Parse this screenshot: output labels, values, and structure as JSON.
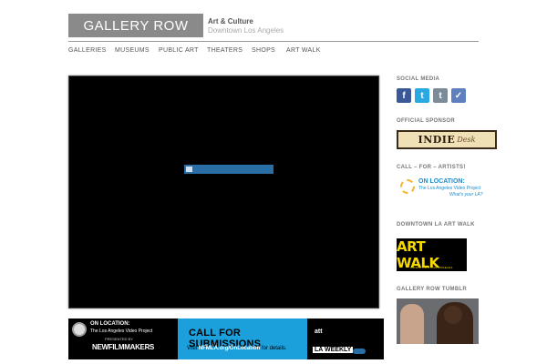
{
  "header": {
    "logo_text": "GALLERY ROW",
    "tagline_line1": "Art & Culture",
    "tagline_line2": "Downtown Los Angeles"
  },
  "nav": {
    "items": [
      {
        "label": "GALLERIES"
      },
      {
        "label": "MUSEUMS"
      },
      {
        "label": "PUBLIC ART"
      },
      {
        "label": "THEATERS"
      },
      {
        "label": "SHOPS"
      },
      {
        "label": "ART WALK"
      }
    ]
  },
  "video": {
    "player": "video-player",
    "loading_icon": "loading-bar-icon"
  },
  "banner": {
    "left_title": "ON LOCATION:",
    "left_sub": "The Los Angeles Video Project",
    "left_presented": "PRESENTED BY",
    "left_org": "NEWFILMMAKERS",
    "cta_title": "CALL FOR SUBMISSIONS",
    "cta_visit_prefix": "Visit ",
    "cta_visit_link": "NFMLA.org/OnLocation",
    "cta_visit_suffix": " for details.",
    "sponsor1": "att",
    "sponsor2": "LA WEEKLY"
  },
  "sidebar": {
    "social_heading": "SOCIAL MEDIA",
    "social_icons": [
      "facebook-icon",
      "twitter-icon",
      "tumblr-icon",
      "delicious-icon"
    ],
    "sponsor_heading": "OFFICIAL SPONSOR",
    "sponsor_name": "INDIE",
    "sponsor_suffix": "Desk",
    "call_heading": "CALL – FOR – ARTISTS!",
    "onloc_title": "ON LOCATION:",
    "onloc_sub": "The Los Angeles Video Project",
    "onloc_tag": "What's your LA?",
    "artwalk_heading": "DOWNTOWN LA ART WALK",
    "artwalk_logo": "ART WALK",
    "artwalk_sub": "DOWNTOWN LOS ANGELES",
    "tumblr_heading": "GALLERY ROW TUMBLR"
  },
  "colors": {
    "logo_bg": "#8a8a8a",
    "loader": "#2a6ea6",
    "cta_bg": "#1ba0dc",
    "artwalk_yellow": "#f5d800"
  }
}
